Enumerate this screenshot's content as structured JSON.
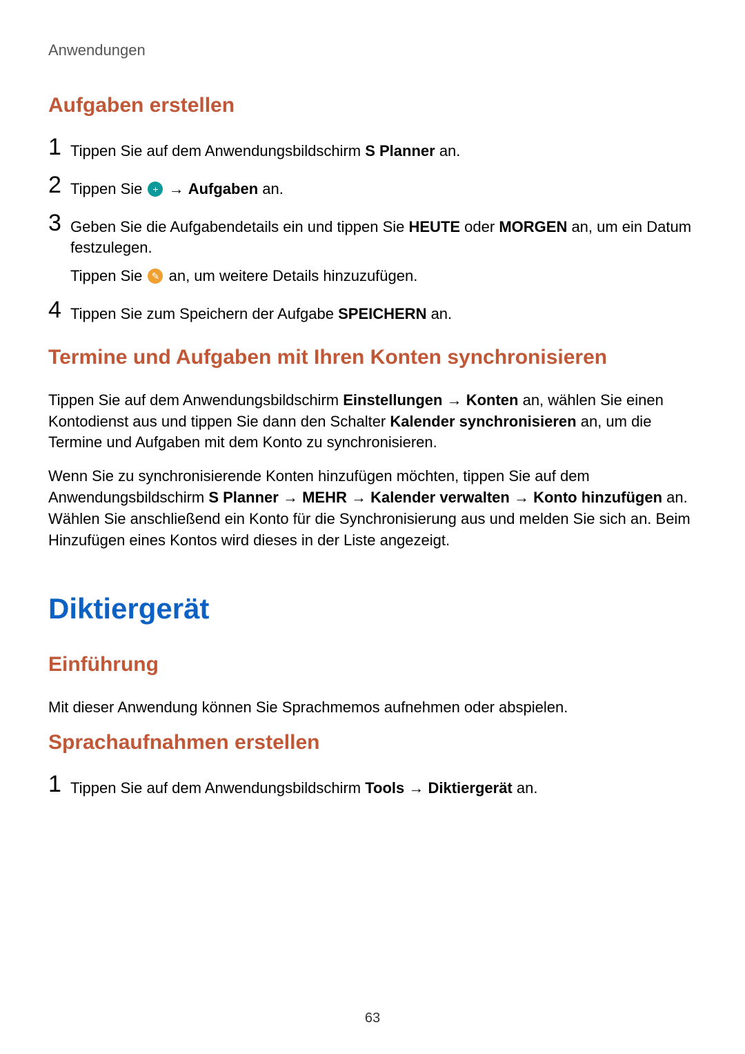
{
  "breadcrumb": "Anwendungen",
  "section1": {
    "title": "Aufgaben erstellen",
    "steps": {
      "s1": {
        "num": "1",
        "t1": "Tippen Sie auf dem Anwendungsbildschirm ",
        "b1": "S Planner",
        "t2": " an."
      },
      "s2": {
        "num": "2",
        "t1": "Tippen Sie ",
        "icon": "plus-icon",
        "t2": " → ",
        "b1": "Aufgaben",
        "t3": " an."
      },
      "s3": {
        "num": "3",
        "t1": "Geben Sie die Aufgabendetails ein und tippen Sie ",
        "b1": "HEUTE",
        "t2": " oder ",
        "b2": "MORGEN",
        "t3": " an, um ein Datum festzulegen.",
        "sub_t1": "Tippen Sie ",
        "sub_icon": "expand-icon",
        "sub_t2": " an, um weitere Details hinzuzufügen."
      },
      "s4": {
        "num": "4",
        "t1": "Tippen Sie zum Speichern der Aufgabe ",
        "b1": "SPEICHERN",
        "t2": " an."
      }
    }
  },
  "section2": {
    "title": "Termine und Aufgaben mit Ihren Konten synchronisieren",
    "p1": {
      "t1": "Tippen Sie auf dem Anwendungsbildschirm ",
      "b1": "Einstellungen",
      "t2": " → ",
      "b2": "Konten",
      "t3": " an, wählen Sie einen Kontodienst aus und tippen Sie dann den Schalter ",
      "b3": "Kalender synchronisieren",
      "t4": " an, um die Termine und Aufgaben mit dem Konto zu synchronisieren."
    },
    "p2": {
      "t1": "Wenn Sie zu synchronisierende Konten hinzufügen möchten, tippen Sie auf dem Anwendungsbildschirm ",
      "b1": "S Planner",
      "t2": " → ",
      "b2": "MEHR",
      "t3": " → ",
      "b3": "Kalender verwalten",
      "t4": " → ",
      "b4": "Konto hinzufügen",
      "t5": " an. Wählen Sie anschließend ein Konto für die Synchronisierung aus und melden Sie sich an. Beim Hinzufügen eines Kontos wird dieses in der Liste angezeigt."
    }
  },
  "chapter": {
    "title": "Diktiergerät"
  },
  "section3": {
    "title": "Einführung",
    "p1": "Mit dieser Anwendung können Sie Sprachmemos aufnehmen oder abspielen."
  },
  "section4": {
    "title": "Sprachaufnahmen erstellen",
    "steps": {
      "s1": {
        "num": "1",
        "t1": "Tippen Sie auf dem Anwendungsbildschirm ",
        "b1": "Tools",
        "t2": " → ",
        "b2": "Diktiergerät",
        "t3": " an."
      }
    }
  },
  "icons": {
    "plus": "+",
    "expand": "✎"
  },
  "pageNumber": "63"
}
